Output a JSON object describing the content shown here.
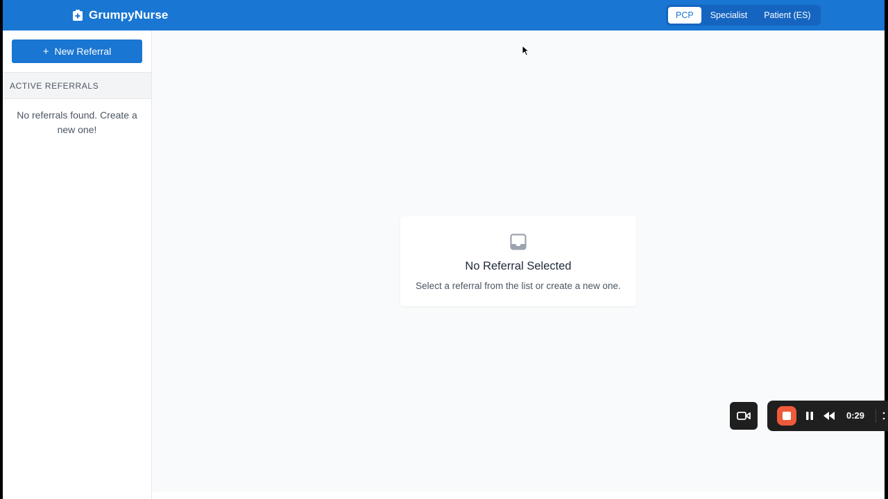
{
  "header": {
    "brand_title": "GrumpyNurse",
    "brand_icon": "medical-kit-icon",
    "roles": [
      {
        "label": "PCP",
        "active": true
      },
      {
        "label": "Specialist",
        "active": false
      },
      {
        "label": "Patient (ES)",
        "active": false
      }
    ]
  },
  "sidebar": {
    "new_button_icon": "+",
    "new_button_label": "New Referral",
    "section_title": "ACTIVE REFERRALS",
    "empty_text": "No referrals found. Create a new one!"
  },
  "main": {
    "empty_icon": "inbox-icon",
    "empty_title": "No Referral Selected",
    "empty_subtitle": "Select a referral from the list or create a new one."
  },
  "recorder": {
    "elapsed": "0:29"
  },
  "colors": {
    "primary": "#1976d2",
    "background": "#f9fafb",
    "record": "#ee5a3a"
  }
}
